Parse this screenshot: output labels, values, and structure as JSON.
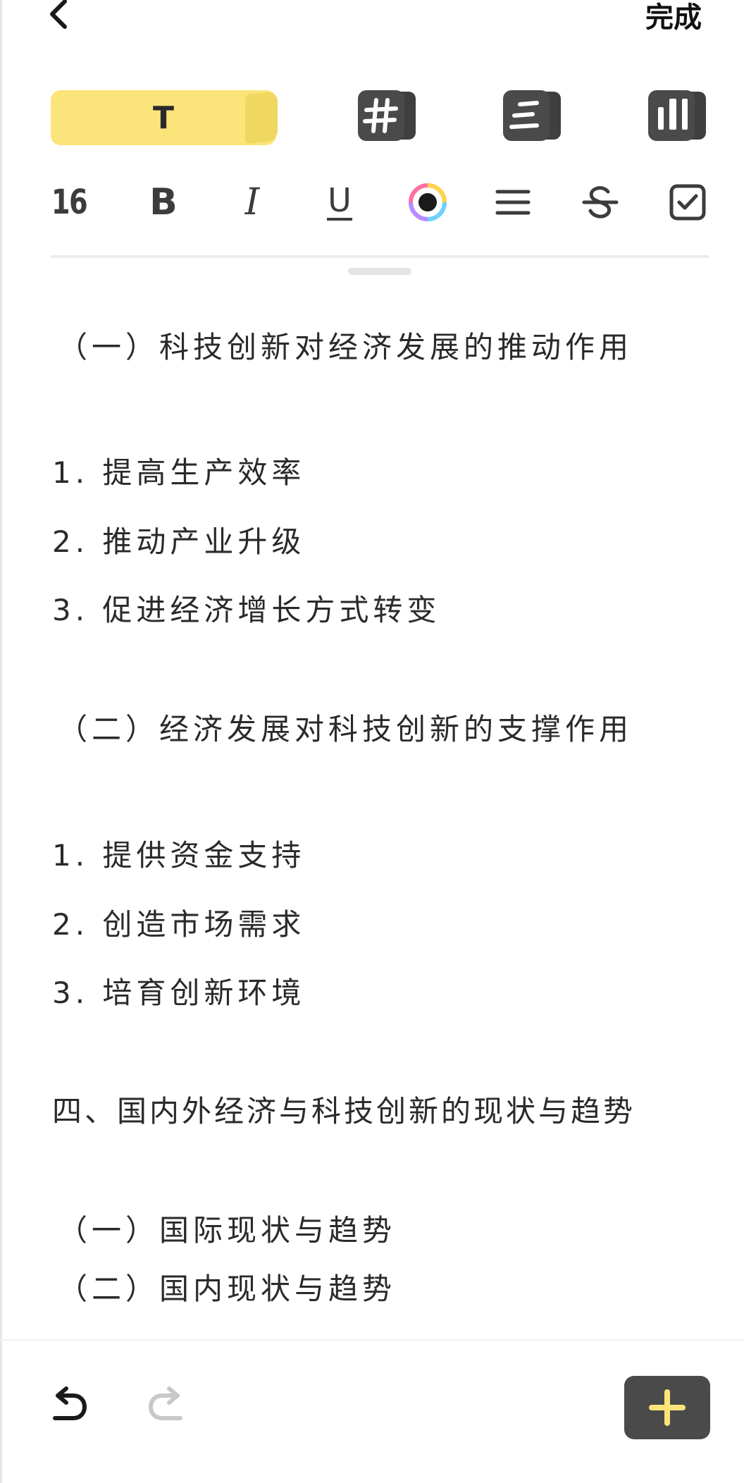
{
  "header": {
    "back_icon": "chevron-left-icon",
    "done_label": "完成"
  },
  "style_bar": {
    "text_style_label": "T",
    "icons": [
      "hash-block-icon",
      "list-block-icon",
      "columns-block-icon"
    ],
    "accent": "#fbe47a"
  },
  "format_bar": {
    "font_size": "16",
    "bold": "B",
    "italic": "I",
    "underline": "U",
    "icons": [
      "color-picker-icon",
      "align-icon",
      "strikethrough-icon",
      "checkbox-icon"
    ]
  },
  "content": {
    "lines": [
      "（一）科技创新对经济发展的推动作用",
      "1. 提高生产效率",
      "2. 推动产业升级",
      "3. 促进经济增长方式转变",
      "（二）经济发展对科技创新的支撑作用",
      "1. 提供资金支持",
      "2. 创造市场需求",
      "3. 培育创新环境",
      "四、国内外经济与科技创新的现状与趋势",
      "（一）国际现状与趋势",
      "（二）国内现状与趋势"
    ]
  },
  "bottom_bar": {
    "icons": [
      "undo-icon",
      "redo-icon",
      "add-icon"
    ],
    "add_button_color": "#4a4a4a",
    "add_icon_color": "#fbe47a"
  }
}
